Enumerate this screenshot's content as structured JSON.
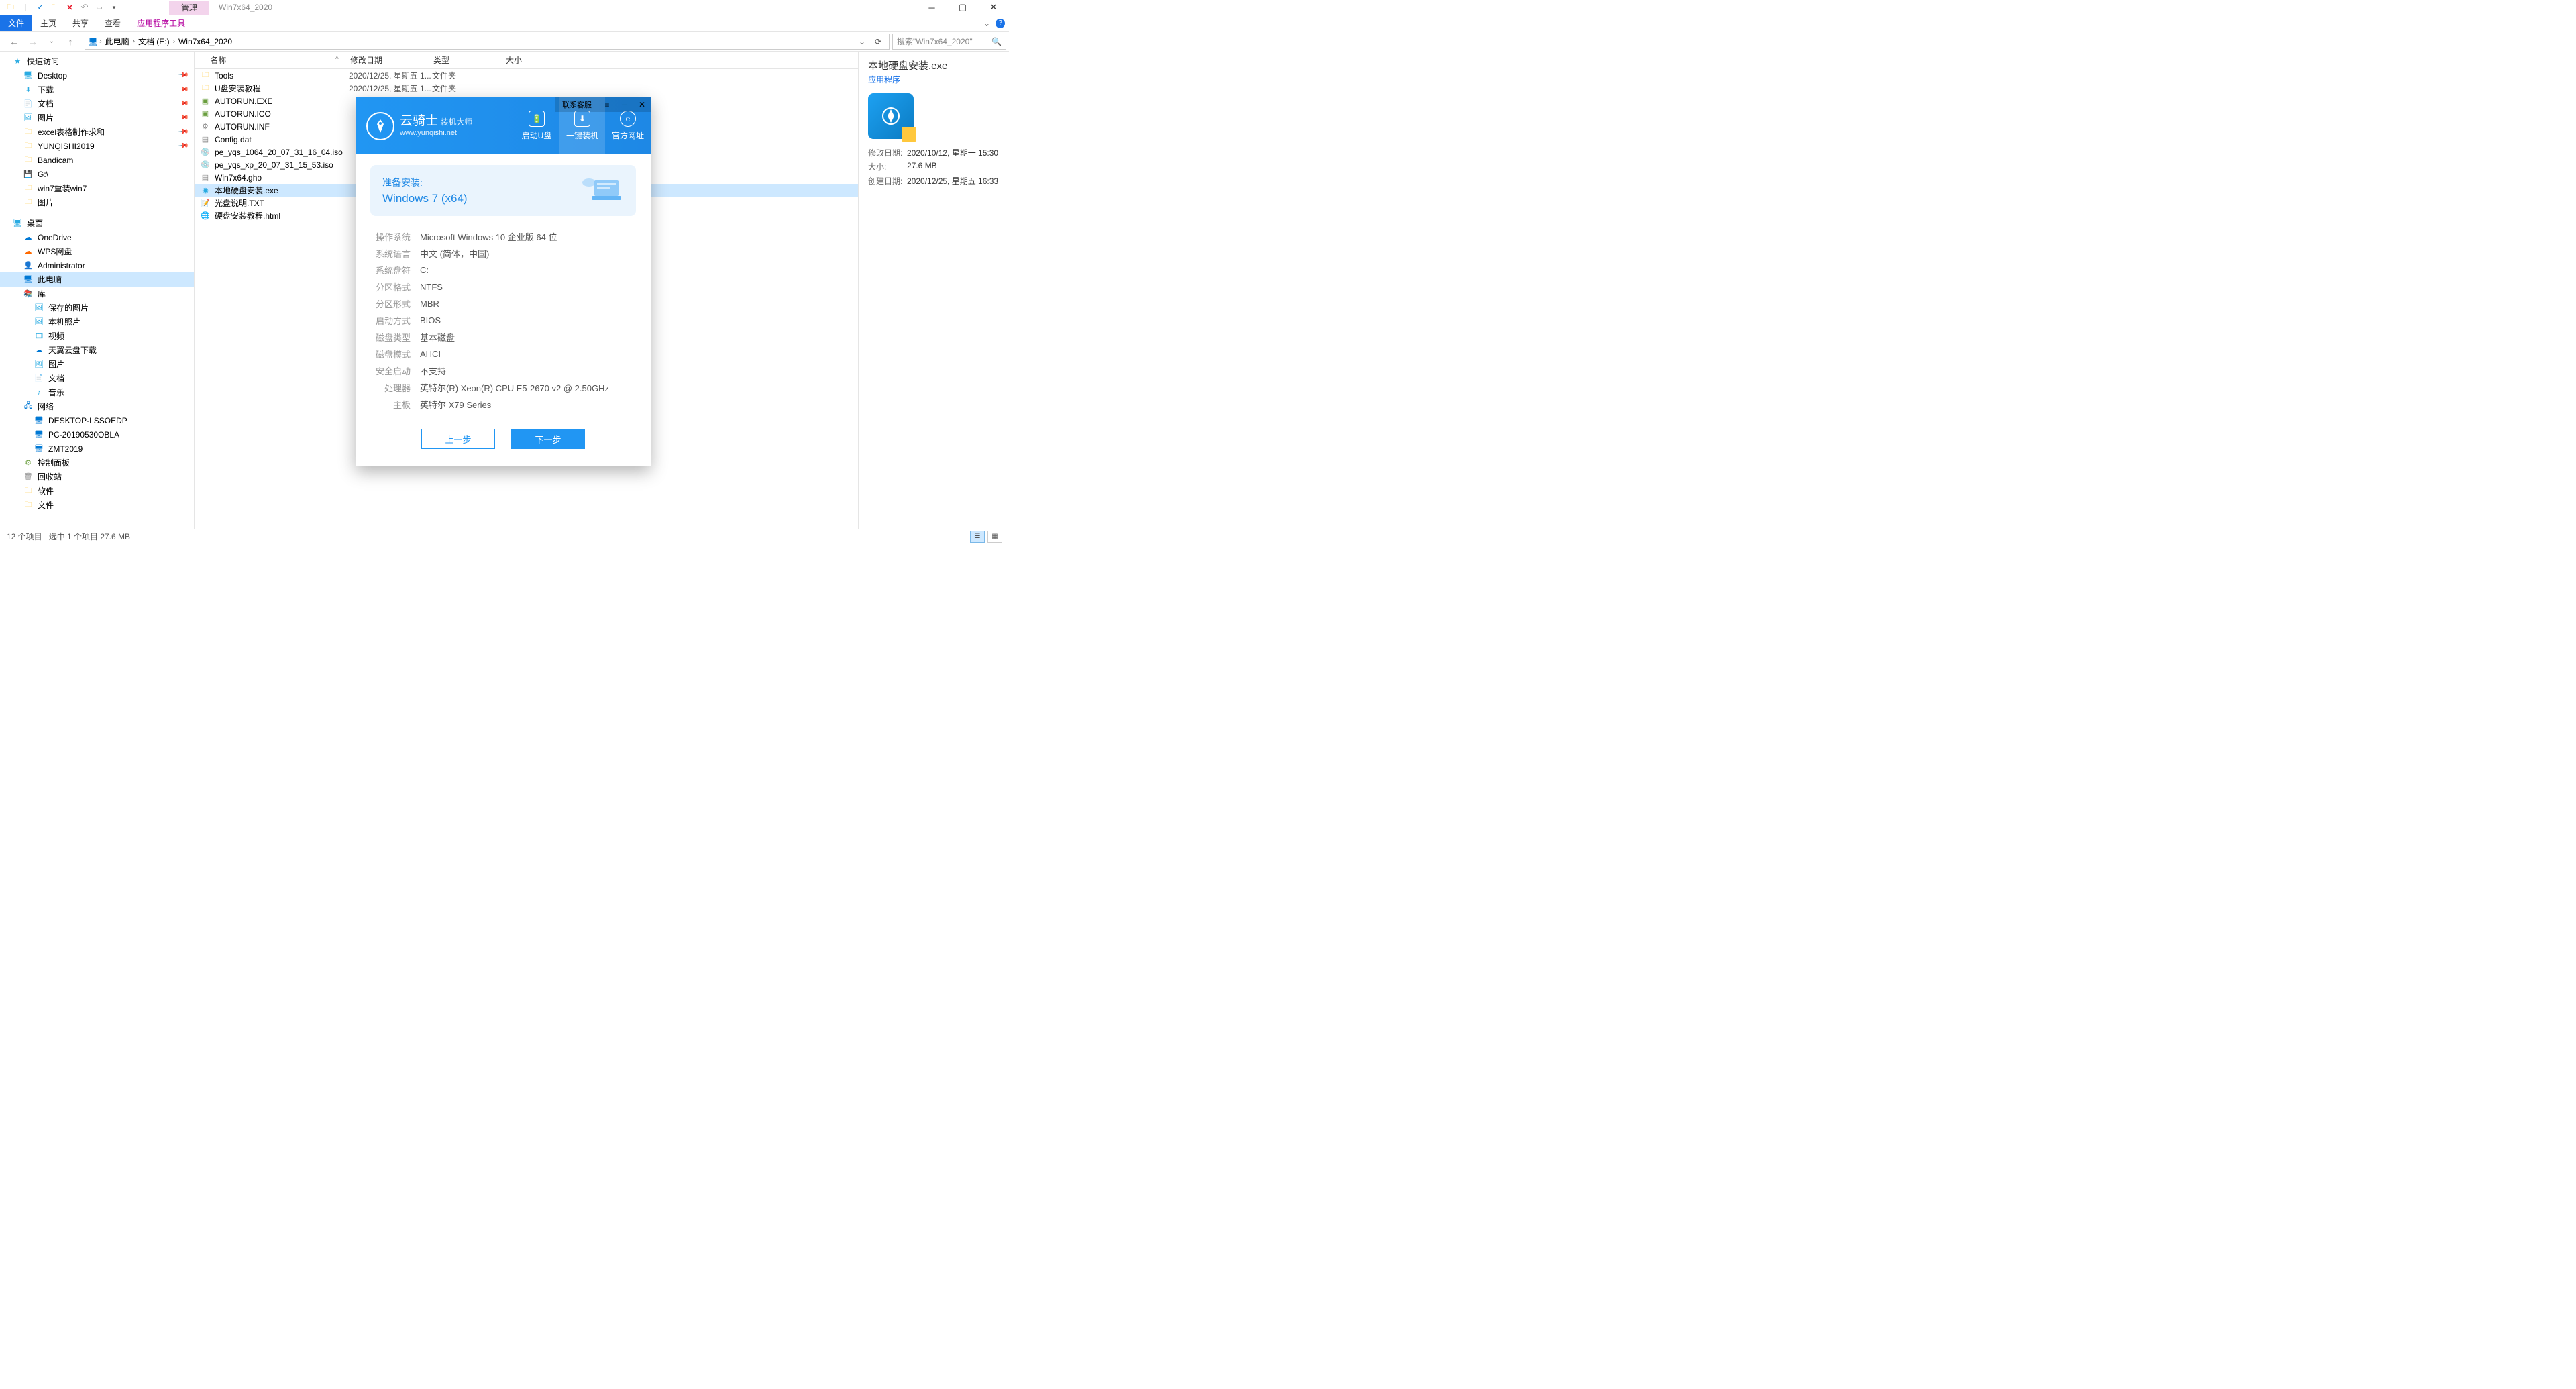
{
  "window": {
    "context_tab": "管理",
    "title": "Win7x64_2020"
  },
  "ribbon": {
    "file": "文件",
    "tabs": [
      "主页",
      "共享",
      "查看",
      "应用程序工具"
    ]
  },
  "address": {
    "segments": [
      "此电脑",
      "文档 (E:)",
      "Win7x64_2020"
    ]
  },
  "search": {
    "placeholder": "搜索\"Win7x64_2020\""
  },
  "nav": {
    "quick": "快速访问",
    "quick_items": [
      {
        "label": "Desktop",
        "icon": "desk",
        "pin": true
      },
      {
        "label": "下载",
        "icon": "dl",
        "pin": true
      },
      {
        "label": "文档",
        "icon": "doc",
        "pin": true
      },
      {
        "label": "图片",
        "icon": "pic",
        "pin": true
      },
      {
        "label": "excel表格制作求和",
        "icon": "folder",
        "pin": true
      },
      {
        "label": "YUNQISHI2019",
        "icon": "folder",
        "pin": true
      },
      {
        "label": "Bandicam",
        "icon": "folder",
        "pin": false
      },
      {
        "label": "G:\\",
        "icon": "drive",
        "pin": false
      },
      {
        "label": "win7重装win7",
        "icon": "folder",
        "pin": false
      },
      {
        "label": "图片",
        "icon": "folder",
        "pin": false
      }
    ],
    "desktop": "桌面",
    "desktop_items": [
      {
        "label": "OneDrive",
        "icon": "cloud"
      },
      {
        "label": "WPS网盘",
        "icon": "cloud"
      },
      {
        "label": "Administrator",
        "icon": "user"
      },
      {
        "label": "此电脑",
        "icon": "pc",
        "sel": true
      },
      {
        "label": "库",
        "icon": "lib"
      }
    ],
    "lib_items": [
      {
        "label": "保存的图片"
      },
      {
        "label": "本机照片"
      },
      {
        "label": "视频"
      },
      {
        "label": "天翼云盘下载"
      },
      {
        "label": "图片"
      },
      {
        "label": "文档"
      },
      {
        "label": "音乐"
      }
    ],
    "network": "网络",
    "net_items": [
      "DESKTOP-LSSOEDP",
      "PC-20190530OBLA",
      "ZMT2019"
    ],
    "panel": "控制面板",
    "recycle": "回收站",
    "soft": "软件",
    "files": "文件"
  },
  "columns": {
    "name": "名称",
    "date": "修改日期",
    "type": "类型",
    "size": "大小"
  },
  "files": [
    {
      "name": "Tools",
      "date": "2020/12/25, 星期五 1...",
      "type": "文件夹",
      "icon": "fold"
    },
    {
      "name": "U盘安装教程",
      "date": "2020/12/25, 星期五 1...",
      "type": "文件夹",
      "icon": "fold"
    },
    {
      "name": "AUTORUN.EXE",
      "date": "",
      "type": "",
      "icon": "exe"
    },
    {
      "name": "AUTORUN.ICO",
      "date": "",
      "type": "",
      "icon": "icof"
    },
    {
      "name": "AUTORUN.INF",
      "date": "",
      "type": "",
      "icon": "inf"
    },
    {
      "name": "Config.dat",
      "date": "",
      "type": "",
      "icon": "dat"
    },
    {
      "name": "pe_yqs_1064_20_07_31_16_04.iso",
      "date": "",
      "type": "",
      "icon": "iso"
    },
    {
      "name": "pe_yqs_xp_20_07_31_15_53.iso",
      "date": "",
      "type": "",
      "icon": "iso"
    },
    {
      "name": "Win7x64.gho",
      "date": "",
      "type": "",
      "icon": "gho"
    },
    {
      "name": "本地硬盘安装.exe",
      "date": "",
      "type": "",
      "icon": "app",
      "sel": true
    },
    {
      "name": "光盘说明.TXT",
      "date": "",
      "type": "",
      "icon": "txt"
    },
    {
      "name": "硬盘安装教程.html",
      "date": "",
      "type": "",
      "icon": "html"
    }
  ],
  "details": {
    "title": "本地硬盘安装.exe",
    "subtitle": "应用程序",
    "rows": [
      {
        "label": "修改日期:",
        "value": "2020/10/12, 星期一 15:30"
      },
      {
        "label": "大小:",
        "value": "27.6 MB"
      },
      {
        "label": "创建日期:",
        "value": "2020/12/25, 星期五 16:33"
      }
    ]
  },
  "status": {
    "count": "12 个项目",
    "selected": "选中 1 个项目  27.6 MB"
  },
  "popup": {
    "titlebar": "联系客服",
    "logo_main": "云骑士",
    "logo_tag": "装机大师",
    "logo_url": "www.yunqishi.net",
    "nav": [
      "启动U盘",
      "一键装机",
      "官方网址"
    ],
    "banner_title": "准备安装:",
    "banner_os": "Windows 7 (x64)",
    "info": [
      {
        "label": "操作系统",
        "value": "Microsoft Windows 10 企业版 64 位"
      },
      {
        "label": "系统语言",
        "value": "中文 (简体，中国)"
      },
      {
        "label": "系统盘符",
        "value": "C:"
      },
      {
        "label": "分区格式",
        "value": "NTFS"
      },
      {
        "label": "分区形式",
        "value": "MBR"
      },
      {
        "label": "启动方式",
        "value": "BIOS"
      },
      {
        "label": "磁盘类型",
        "value": "基本磁盘"
      },
      {
        "label": "磁盘模式",
        "value": "AHCI"
      },
      {
        "label": "安全启动",
        "value": "不支持"
      },
      {
        "label": "处理器",
        "value": "英特尔(R) Xeon(R) CPU E5-2670 v2 @ 2.50GHz"
      },
      {
        "label": "主板",
        "value": "英特尔 X79 Series"
      }
    ],
    "btn_prev": "上一步",
    "btn_next": "下一步"
  }
}
